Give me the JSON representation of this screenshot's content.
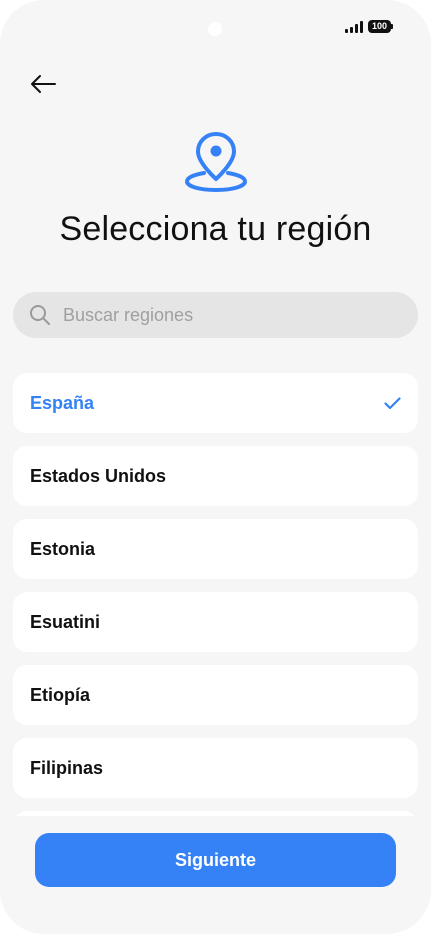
{
  "status_bar": {
    "battery": "100",
    "battery_icon": "battery-icon",
    "signal_icon": "signal-icon"
  },
  "header": {
    "back_icon": "arrow-left-icon",
    "hero_icon": "location-pin-icon",
    "title": "Selecciona tu región"
  },
  "search": {
    "placeholder": "Buscar regiones",
    "value": "",
    "icon": "search-icon"
  },
  "regions": [
    {
      "label": "España",
      "selected": true
    },
    {
      "label": "Estados Unidos",
      "selected": false
    },
    {
      "label": "Estonia",
      "selected": false
    },
    {
      "label": "Esuatini",
      "selected": false
    },
    {
      "label": "Etiopía",
      "selected": false
    },
    {
      "label": "Filipinas",
      "selected": false
    },
    {
      "label": "",
      "selected": false
    }
  ],
  "footer": {
    "next_label": "Siguiente"
  },
  "colors": {
    "accent": "#3482f6",
    "background": "#f6f6f6",
    "card": "#ffffff",
    "search_bg": "#e5e5e5"
  }
}
